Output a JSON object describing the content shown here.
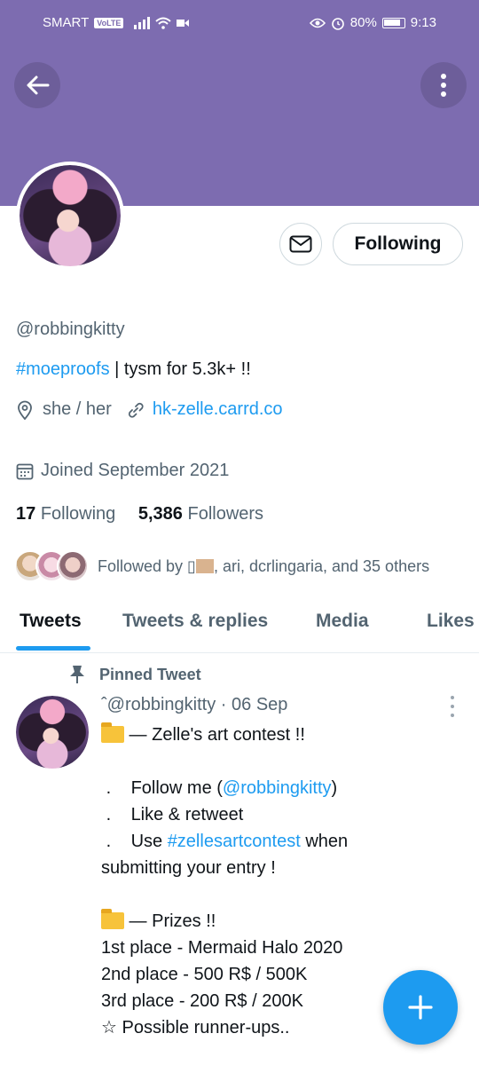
{
  "status_bar": {
    "carrier": "SMART",
    "volte": "VoLTE",
    "battery": "80%",
    "time": "9:13"
  },
  "colors": {
    "banner": "#7d6cb0",
    "accent": "#1d9bf0",
    "muted_text": "#536471"
  },
  "icons": [
    "back-arrow-icon",
    "more-vert-icon",
    "mail-icon",
    "location-icon",
    "link-icon",
    "calendar-icon",
    "pin-icon",
    "folder-icon",
    "plus-icon"
  ],
  "profile": {
    "following_button": "Following",
    "handle": "@robbingkitty",
    "bio_hashtag": "#moeproofs",
    "bio_rest": " | tysm for 5.3k+ !!",
    "pronouns": "she / her",
    "website": "hk-zelle.carrd.co",
    "joined": "Joined September 2021",
    "following_count": "17",
    "following_label": "Following",
    "followers_count": "5,386",
    "followers_label": "Followers",
    "followed_by_prefix": "Followed by ▯",
    "followed_by_rest": ", ari, dcrlingaria, and 35 others"
  },
  "tabs": [
    {
      "label": "Tweets"
    },
    {
      "label": "Tweets & replies"
    },
    {
      "label": "Media"
    },
    {
      "label": "Likes"
    }
  ],
  "pinned_tweet": {
    "pinned_label": "Pinned Tweet",
    "header": "ˆ@robbingkitty · 06 Sep",
    "line1": " — Zelle's art contest !!",
    "bullet": ".",
    "follow_prefix": "Follow me (",
    "follow_handle": "@robbingkitty",
    "follow_suffix": ")",
    "like_retweet": "Like & retweet",
    "use_prefix": "Use ",
    "use_hashtag": "#zellesartcontest",
    "use_suffix": " when",
    "use_line2": "submitting your entry !",
    "prizes": " — Prizes !!",
    "first": "1st place - Mermaid Halo 2020",
    "second": "2nd place - 500 R$ / 500K",
    "third": "3rd place - 200 R$ / 200K",
    "runnerups": "☆ Possible runner-ups.."
  }
}
